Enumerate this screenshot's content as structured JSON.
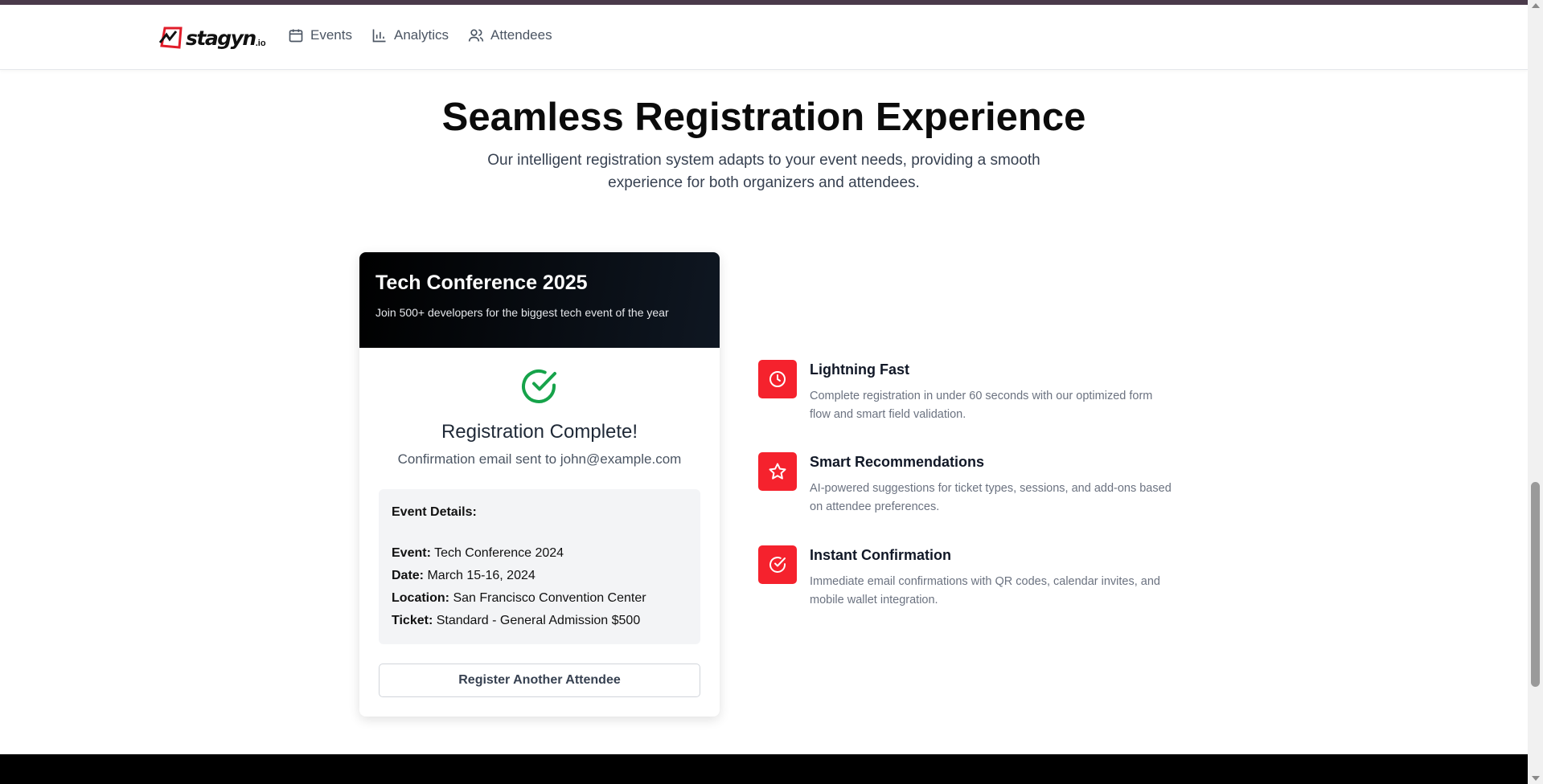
{
  "brand": {
    "name": "stagyn",
    "tld": ".io"
  },
  "nav": [
    {
      "label": "Events",
      "icon": "calendar-icon"
    },
    {
      "label": "Analytics",
      "icon": "bar-chart-icon"
    },
    {
      "label": "Attendees",
      "icon": "users-icon"
    }
  ],
  "hero": {
    "title": "Seamless Registration Experience",
    "subtitle": "Our intelligent registration system adapts to your event needs, providing a smooth experience for both organizers and attendees."
  },
  "card": {
    "title": "Tech Conference 2025",
    "description": "Join 500+ developers for the biggest tech event of the year",
    "status_title": "Registration Complete!",
    "status_sub": "Confirmation email sent to john@example.com",
    "details_heading": "Event Details:",
    "details": [
      {
        "label": "Event:",
        "value": "Tech Conference 2024"
      },
      {
        "label": "Date:",
        "value": "March 15-16, 2024"
      },
      {
        "label": "Location:",
        "value": "San Francisco Convention Center"
      },
      {
        "label": "Ticket:",
        "value": "Standard - General Admission $500"
      }
    ],
    "button_label": "Register Another Attendee"
  },
  "features": [
    {
      "title": "Lightning Fast",
      "description": "Complete registration in under 60 seconds with our optimized form flow and smart field validation.",
      "icon": "clock-icon"
    },
    {
      "title": "Smart Recommendations",
      "description": "AI-powered suggestions for ticket types, sessions, and add-ons based on attendee preferences.",
      "icon": "star-icon"
    },
    {
      "title": "Instant Confirmation",
      "description": "Immediate email confirmations with QR codes, calendar invites, and mobile wallet integration.",
      "icon": "check-circle-icon"
    }
  ],
  "colors": {
    "accent": "#f5222d",
    "success": "#16a34a",
    "header_dark": "#0b0f17"
  }
}
